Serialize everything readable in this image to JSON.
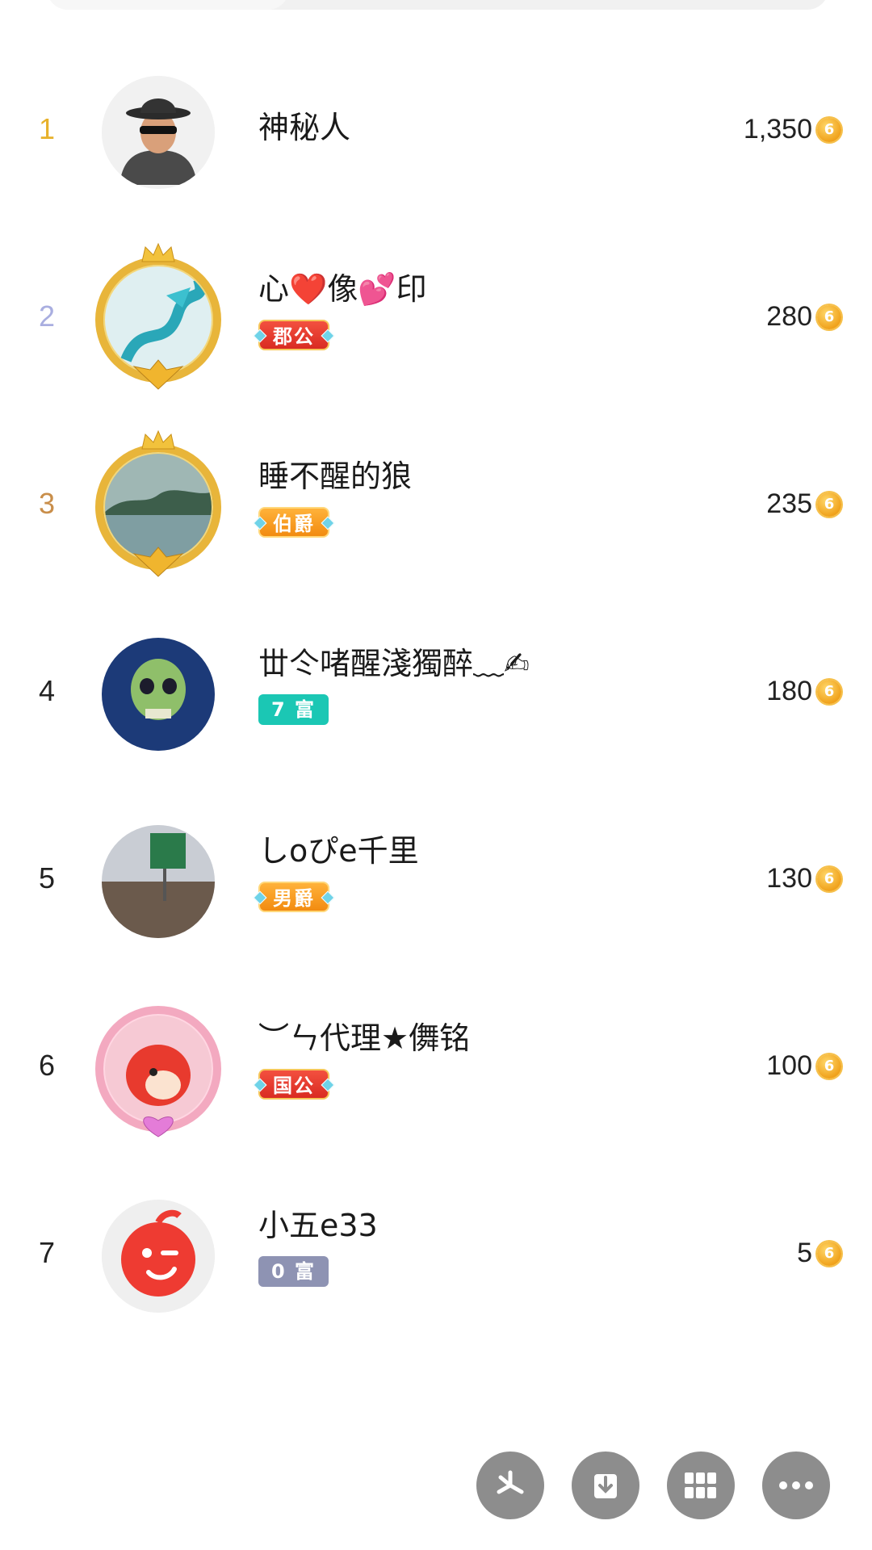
{
  "colors": {
    "rank_1": "#e7b12b",
    "rank_2": "#a9aee0",
    "rank_3": "#c98e4a",
    "rank_default": "#222222",
    "coin": "#f0a21c",
    "fab": "#8d8d8d"
  },
  "leaderboard": [
    {
      "rank": "1",
      "name": "神秘人",
      "coins": "1,350",
      "badge": null,
      "avatar": "mystery-man-avatar",
      "frame": false
    },
    {
      "rank": "2",
      "name": "心❤️像💕印",
      "coins": "280",
      "badge": {
        "text": "郡公",
        "style": "title-red"
      },
      "avatar": "dragon-avatar",
      "frame": true
    },
    {
      "rank": "3",
      "name": "睡不醒的狼",
      "coins": "235",
      "badge": {
        "text": "伯爵",
        "style": "title-orange"
      },
      "avatar": "river-landscape-avatar",
      "frame": true
    },
    {
      "rank": "4",
      "name": "丗仒啫醒淺獨醉﹏✍",
      "coins": "180",
      "badge": {
        "text": "7 富",
        "style": "rich-teal"
      },
      "avatar": "skull-avatar",
      "frame": false
    },
    {
      "rank": "5",
      "name": "しoぴe千里",
      "coins": "130",
      "badge": {
        "text": "男爵",
        "style": "title-orange"
      },
      "avatar": "highway-sign-avatar",
      "frame": false
    },
    {
      "rank": "6",
      "name": "︶ㄣ代理★儛铭",
      "coins": "100",
      "badge": {
        "text": "国公",
        "style": "title-red"
      },
      "avatar": "fox-cartoon-avatar",
      "frame": true
    },
    {
      "rank": "7",
      "name": "小五e33",
      "coins": "5",
      "badge": {
        "text": "0 富",
        "style": "rich-gray"
      },
      "avatar": "red-wink-avatar",
      "frame": false
    }
  ],
  "fabs": [
    {
      "icon": "pinwheel-icon"
    },
    {
      "icon": "download-icon"
    },
    {
      "icon": "grid-icon"
    },
    {
      "icon": "more-icon"
    }
  ]
}
